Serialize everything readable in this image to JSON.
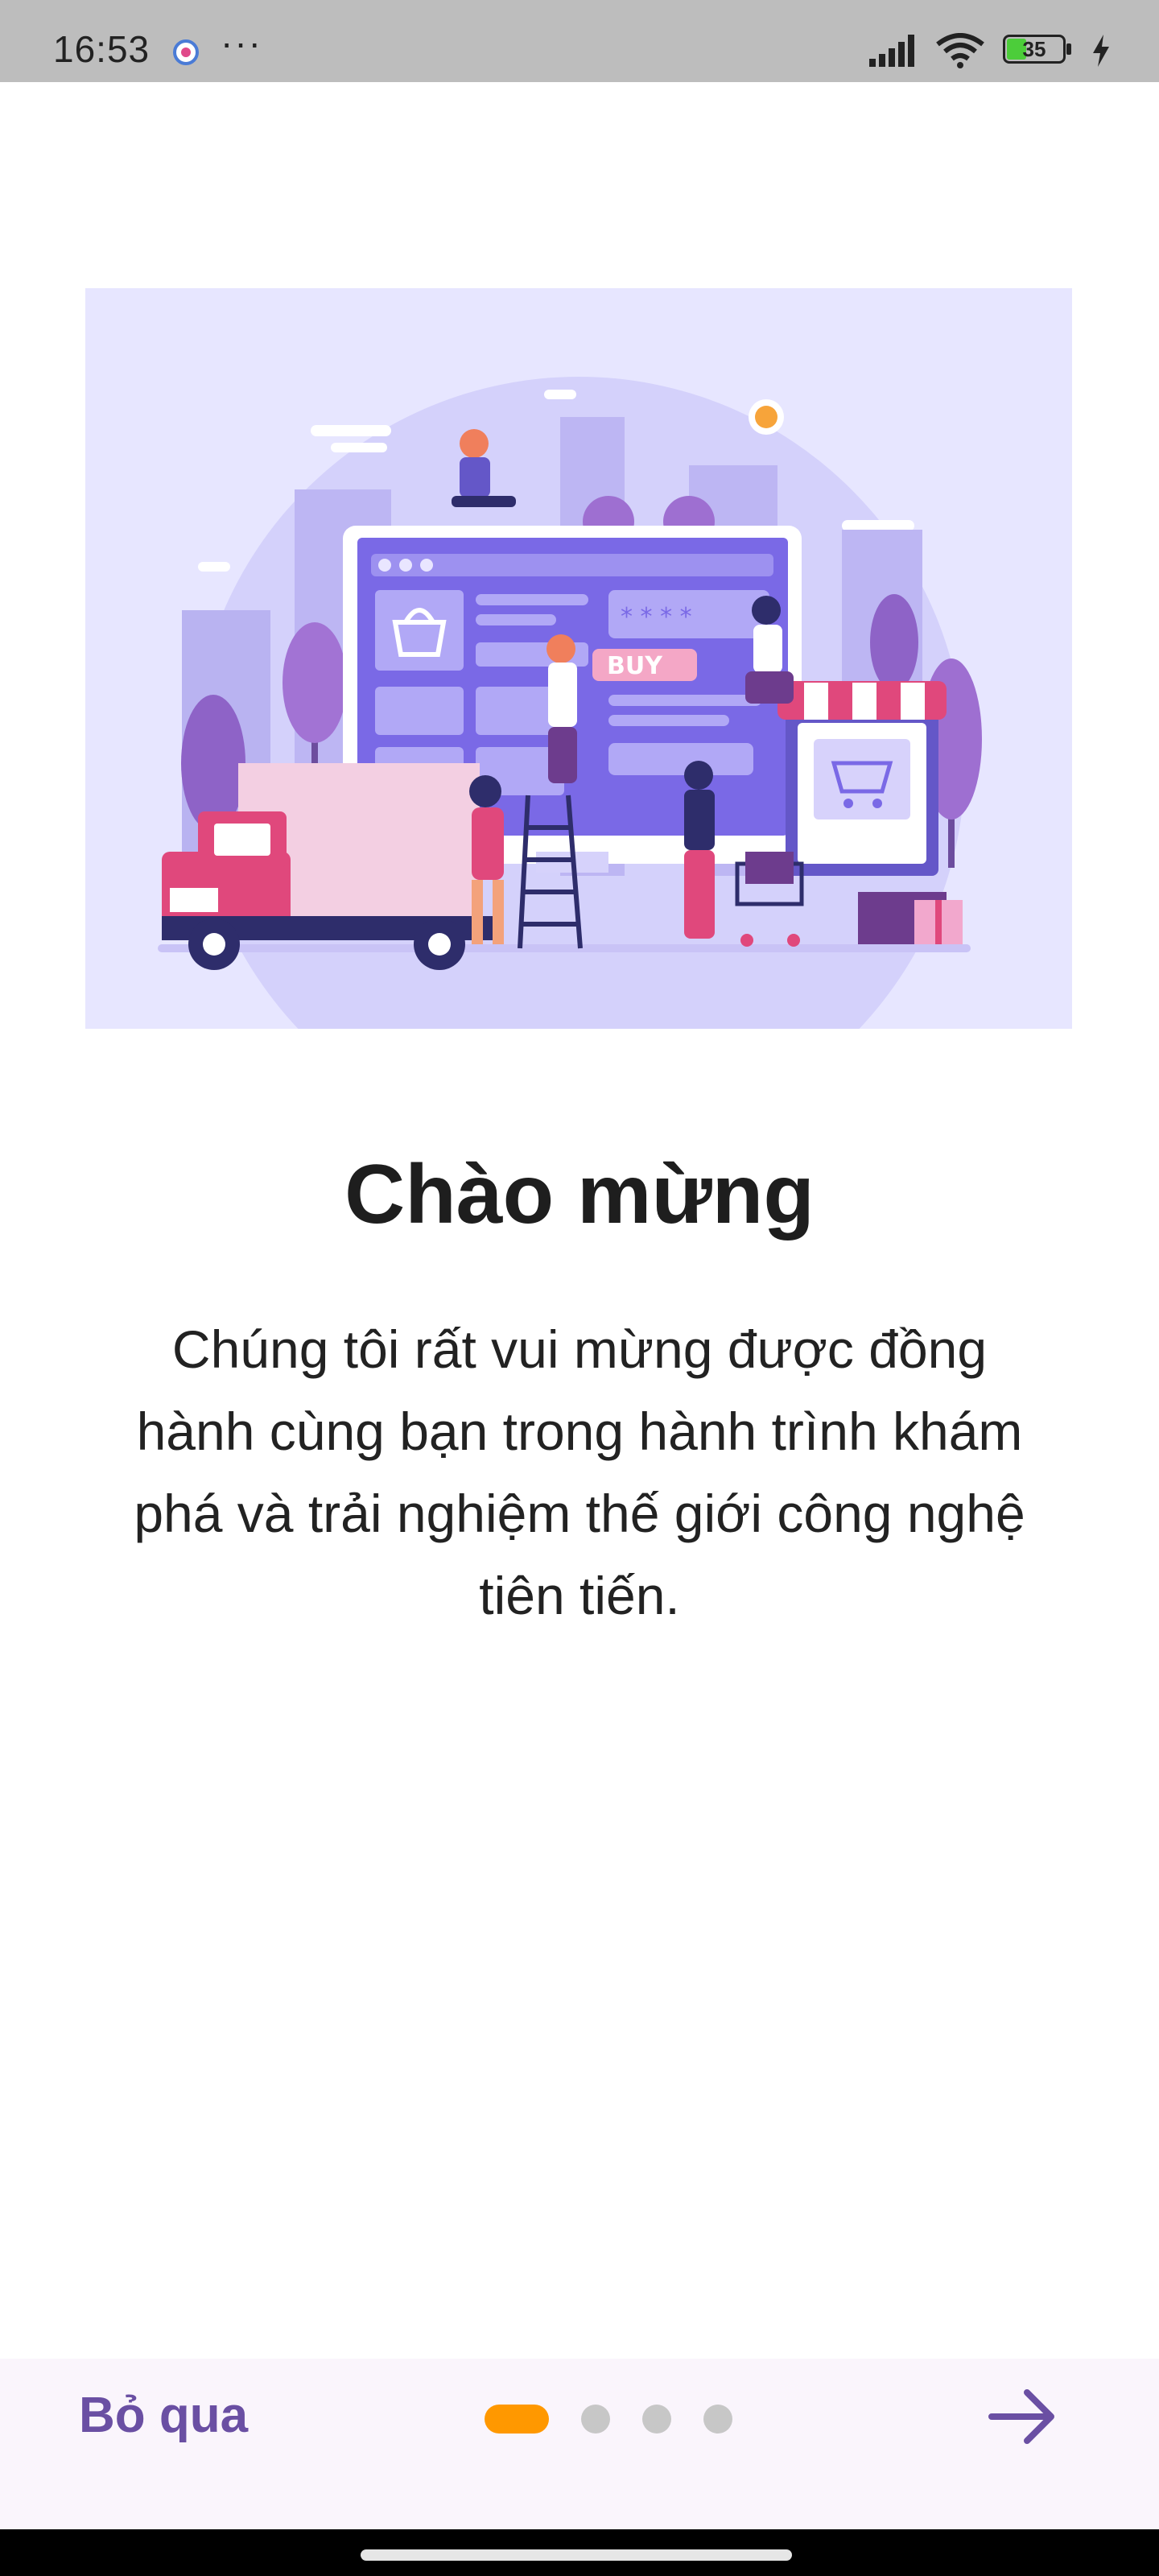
{
  "status_bar": {
    "time": "16:53",
    "more": "···",
    "battery": "35",
    "icons": [
      "app-notification-icon",
      "signal-icon",
      "wifi-icon",
      "battery-icon",
      "charging-icon"
    ]
  },
  "onboarding": {
    "title": "Chào mừng",
    "description": "Chúng tôi rất vui mừng được đồng hành cùng bạn trong hành trình khám phá và trải nghiệm thế giới công nghệ tiên tiến.",
    "illustration_label": "BUY"
  },
  "navigation": {
    "skip_label": "Bỏ qua",
    "page_count": 4,
    "current_page": 1,
    "next_icon": "arrow-right-icon"
  },
  "colors": {
    "accent": "#6a4fa3",
    "active_dot": "#ff9800",
    "inactive_dot": "#c7c7c7",
    "hero_bg": "#e7e6ff"
  }
}
